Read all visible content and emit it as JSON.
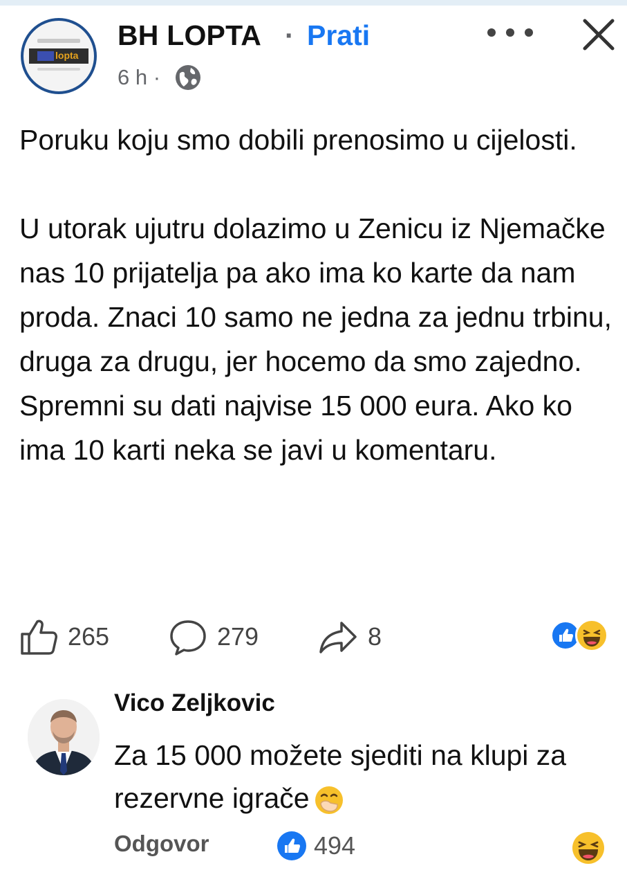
{
  "header": {
    "page_name": "BH LOPTA",
    "separator": "·",
    "follow_label": "Prati",
    "time": "6 h ·",
    "logo_text": "lopta"
  },
  "post": {
    "paragraph1": "Poruku koju smo dobili prenosimo u cijelosti.",
    "paragraph2": "U utorak ujutru dolazimo u Zenicu iz Njemačke nas 10 prijatelja pa ako ima ko karte da nam proda. Znaci 10 samo ne jedna za jednu trbinu, druga za drugu, jer hocemo da smo zajedno. Spremni su dati najvise 15 000 eura. Ako ko ima 10 karti neka se javi u komentaru."
  },
  "actions": {
    "likes": "265",
    "comments": "279",
    "shares": "8"
  },
  "comment": {
    "author": "Vico Zeljkovic",
    "text": "Za 15 000 možete sjediti na klupi za rezervne igrače",
    "reply_label": "Odgovor",
    "like_count": "494"
  },
  "colors": {
    "accent": "#1877f2",
    "page_ring": "#1f4f8f",
    "haha": "#f7c02b"
  }
}
